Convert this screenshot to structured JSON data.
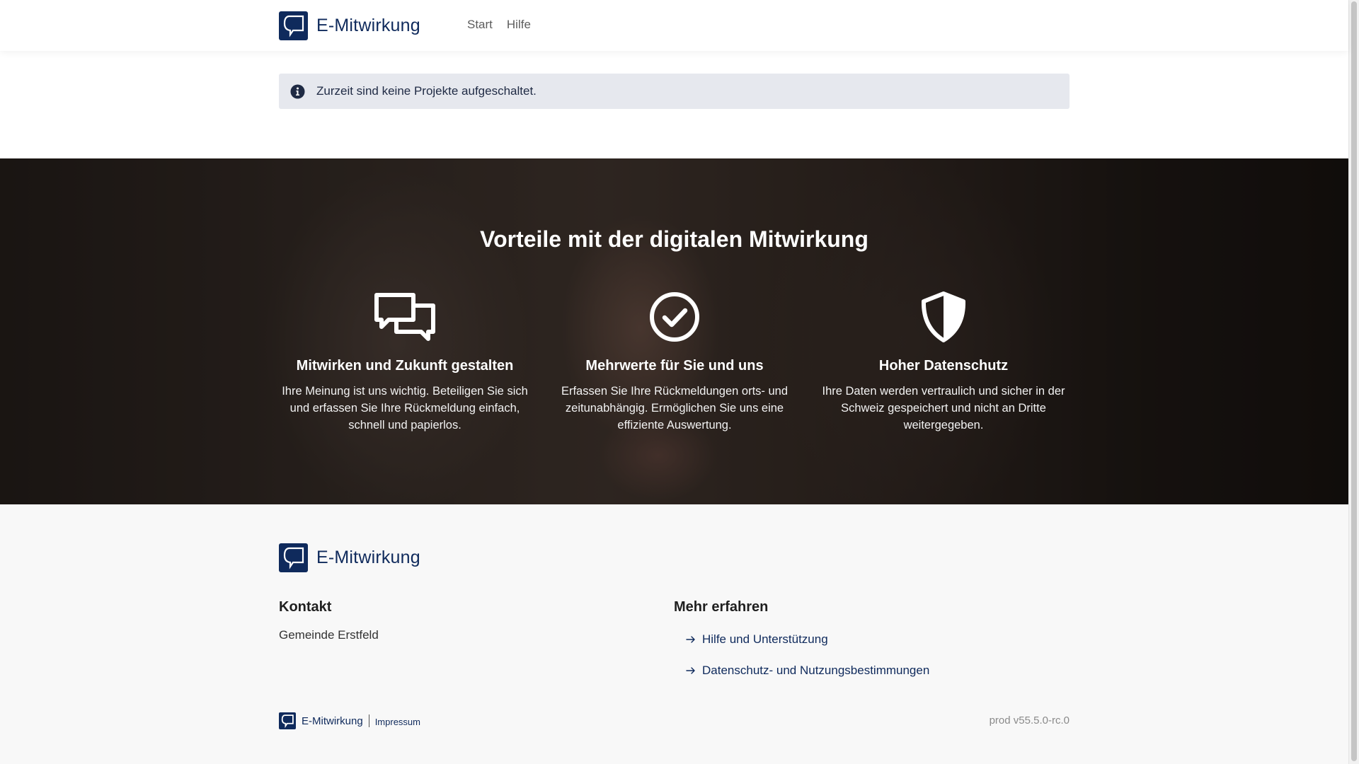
{
  "header": {
    "brand": "E-Mitwirkung",
    "nav": [
      {
        "label": "Start"
      },
      {
        "label": "Hilfe"
      }
    ]
  },
  "alert": {
    "icon": "info-circle-icon",
    "text": "Zurzeit sind keine Projekte aufgeschaltet."
  },
  "hero": {
    "title": "Vorteile mit der digitalen Mitwirkung",
    "features": [
      {
        "icon": "chat-bubbles-icon",
        "title": "Mitwirken und Zukunft gestalten",
        "text": "Ihre Meinung ist uns wichtig. Beteiligen Sie sich und erfassen Sie Ihre Rückmeldung einfach, schnell und papierlos."
      },
      {
        "icon": "check-circle-icon",
        "title": "Mehrwerte für Sie und uns",
        "text": "Erfassen Sie Ihre Rückmeldungen orts- und zeitunabhängig. Ermöglichen Sie uns eine effiziente Auswertung."
      },
      {
        "icon": "shield-icon",
        "title": "Hoher Datenschutz",
        "text": "Ihre Daten werden vertraulich und sicher in der Schweiz gespeichert und nicht an Dritte weitergegeben."
      }
    ]
  },
  "footer": {
    "brand": "E-Mitwirkung",
    "contact": {
      "title": "Kontakt",
      "text": "Gemeinde Erstfeld"
    },
    "more": {
      "title": "Mehr erfahren",
      "links": [
        {
          "label": "Hilfe und Unterstützung"
        },
        {
          "label": "Datenschutz- und Nutzungsbestimmungen"
        }
      ]
    },
    "bottom": {
      "brand": "E-Mitwirkung",
      "impressum": "Impressum",
      "version": "prod v55.5.0-rc.0"
    }
  },
  "colors": {
    "brand": "#0f2a5c",
    "alert_bg": "#e6e8ee",
    "footer_bg": "#f8f8f8"
  }
}
